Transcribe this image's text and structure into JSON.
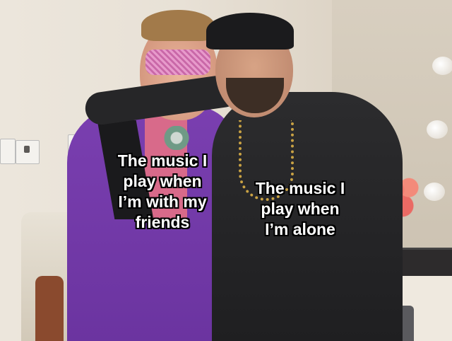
{
  "captions": {
    "left": "The music I\nplay when\nI’m with my\nfriends",
    "right": "The music I\nplay when\nI’m alone"
  }
}
